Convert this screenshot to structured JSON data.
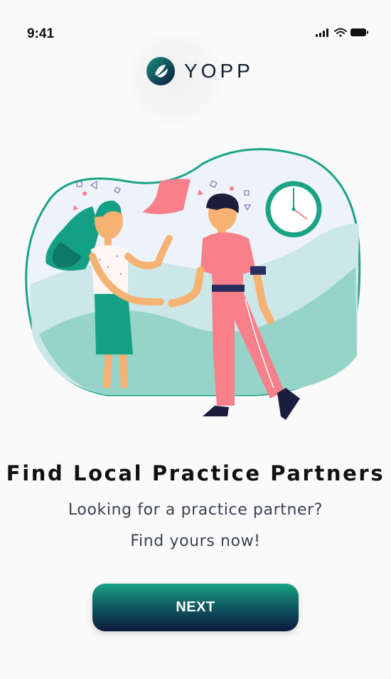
{
  "status_bar": {
    "time": "9:41",
    "icons": [
      "signal-icon",
      "wifi-icon",
      "battery-icon"
    ]
  },
  "brand": {
    "name": "YOPP",
    "logo_icon": "yopp-logo-icon"
  },
  "onboarding": {
    "title": "Find Local Practice Partners",
    "subtitle_line1": "Looking for a practice partner?",
    "subtitle_line2": "Find yours now!",
    "next_label": "NEXT"
  },
  "colors": {
    "teal": "#1aa384",
    "navy": "#0b1a3b",
    "coral": "#f7808a",
    "background": "#fafafa"
  }
}
